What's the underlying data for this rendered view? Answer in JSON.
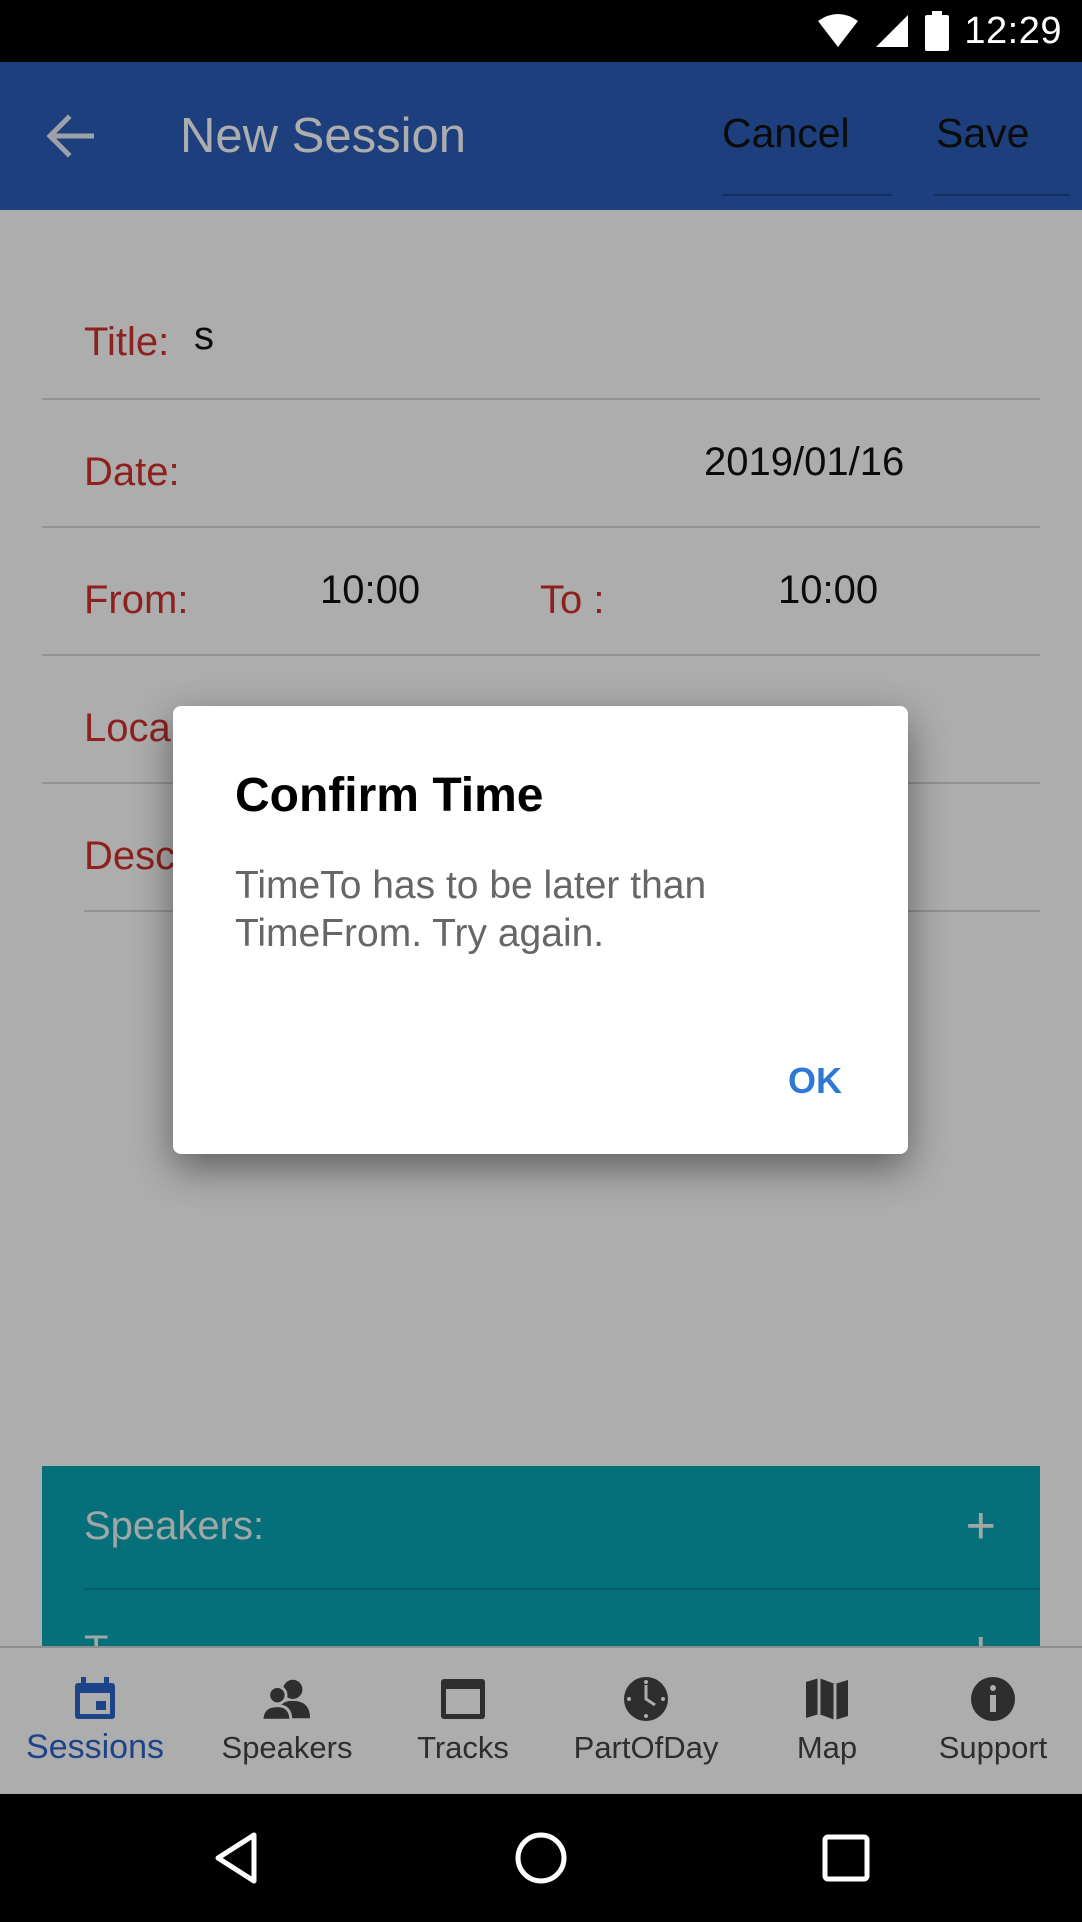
{
  "status_bar": {
    "time": "12:29",
    "icons": [
      "wifi-icon",
      "signal-icon",
      "battery-icon"
    ]
  },
  "app_bar": {
    "title": "New Session",
    "cancel_label": "Cancel",
    "save_label": "Save",
    "background_color": "#2b5db8"
  },
  "form": {
    "title_label": "Title:",
    "title_value": "s",
    "date_label": "Date:",
    "date_value": "2019/01/16",
    "from_label": "From:",
    "from_value": "10:00",
    "to_label": "To :",
    "to_value": "10:00",
    "location_label": "Loca",
    "description_label": "Desc",
    "label_color": "#d0312d"
  },
  "sections": {
    "speakers_label": "Speakers:",
    "tracks_label": "T",
    "add_symbol": "+",
    "color": "#0aa5b4"
  },
  "dialog": {
    "title": "Confirm Time",
    "message": "TimeTo has to be later than TimeFrom. Try again.",
    "ok_label": "OK"
  },
  "bottom_nav": {
    "items": [
      {
        "label": "Sessions",
        "icon": "calendar-icon",
        "active": true
      },
      {
        "label": "Speakers",
        "icon": "people-icon",
        "active": false
      },
      {
        "label": "Tracks",
        "icon": "window-icon",
        "active": false
      },
      {
        "label": "PartOfDay",
        "icon": "clock-icon",
        "active": false
      },
      {
        "label": "Map",
        "icon": "map-icon",
        "active": false
      },
      {
        "label": "Support",
        "icon": "info-icon",
        "active": false
      }
    ],
    "active_color": "#2b63c9"
  },
  "system_nav": {
    "icons": [
      "back-triangle-icon",
      "home-circle-icon",
      "recents-square-icon"
    ]
  }
}
